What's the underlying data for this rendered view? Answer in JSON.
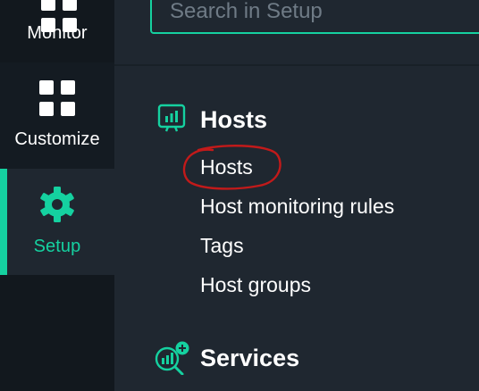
{
  "nav": {
    "items": [
      {
        "label": "Monitor",
        "icon": "monitor-icon",
        "active": false
      },
      {
        "label": "Customize",
        "icon": "grid-icon",
        "active": false
      },
      {
        "label": "Setup",
        "icon": "gear-icon",
        "active": true
      }
    ]
  },
  "search": {
    "placeholder": "Search in Setup",
    "value": ""
  },
  "sections": [
    {
      "title": "Hosts",
      "icon": "hosts-chart-icon",
      "items": [
        "Hosts",
        "Host monitoring rules",
        "Tags",
        "Host groups"
      ]
    },
    {
      "title": "Services",
      "icon": "services-search-icon",
      "items": []
    }
  ],
  "annotation": {
    "target": "Hosts",
    "shape": "hand-drawn red circle"
  },
  "colors": {
    "accent": "#15d1a0",
    "rail_bg": "#12181e",
    "content_bg": "#1f2730",
    "text": "#ffffff",
    "annotation": "#c21a1a"
  }
}
